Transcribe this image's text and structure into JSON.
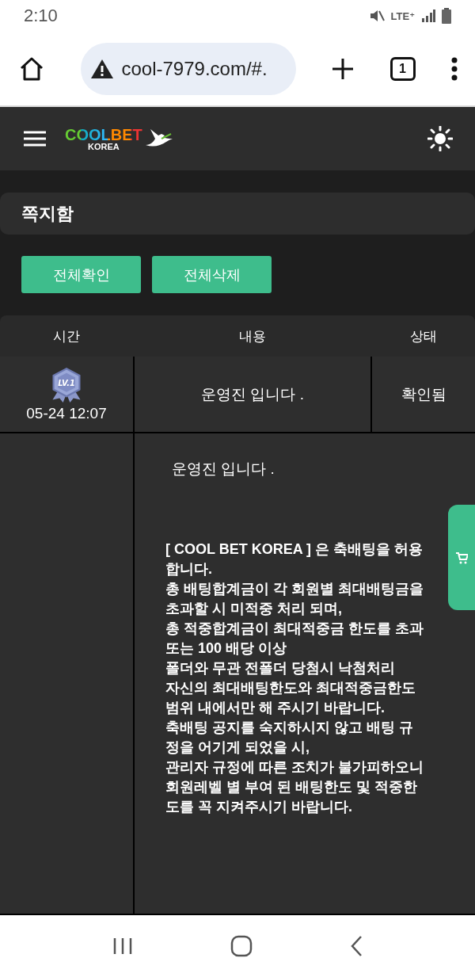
{
  "status_bar": {
    "time": "2:10",
    "network": "LTE⁺"
  },
  "browser": {
    "url": "cool-7979.com/#.",
    "tab_count": "1"
  },
  "header": {
    "logo": "COOLBET",
    "logo_sub": "KOREA"
  },
  "page_title": "쪽지함",
  "buttons": [
    "전체확인",
    "전체삭제"
  ],
  "table": {
    "columns": [
      "시간",
      "내용",
      "상태"
    ],
    "rows": [
      {
        "level_badge": "LV.1",
        "time": "05-24 12:07",
        "subject": "운영진 입니다 .",
        "status": "확인됨"
      }
    ]
  },
  "message": {
    "greeting": "운영진 입니다 .",
    "lines": [
      "[ COOL BET KOREA ] 은 축배팅을 허용",
      "합니다.",
      "총 배팅합계금이 각 회원별 최대배팅금을",
      "초과할 시 미적중 처리 되며,",
      "총 적중합계금이 최대적중금 한도를 초과",
      "또는 100 배당 이상",
      "폴더와 무관 전폴더 당첨시 낙첨처리",
      "자신의 최대배팅한도와 최대적중금한도",
      "범위 내에서만 해 주시기 바랍니다.",
      "축배팅 공지를 숙지하시지 않고 배팅 규",
      "정을 어기게 되었을 시,",
      "관리자 규정에 따른 조치가 불가피하오니",
      "회원레벨 별 부여 된 배팅한도 및 적중한",
      "도를 꼭 지켜주시기 바랍니다."
    ]
  }
}
